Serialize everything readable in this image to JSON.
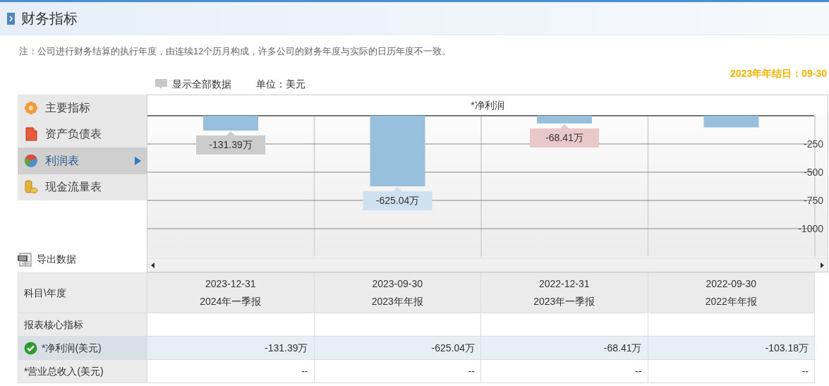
{
  "header": {
    "title": "财务指标"
  },
  "note": "注：公司进行财务结算的执行年度，由连续12个历月构成，许多公司的财务年度与实际的日历年度不一致。",
  "toolbar": {
    "show_all": "显示全部数据",
    "unit": "单位：美元",
    "fiscal_year_end": "2023年年结日：09-30"
  },
  "sidebar": {
    "items": [
      {
        "label": "主要指标",
        "selected": false
      },
      {
        "label": "资产负债表",
        "selected": false
      },
      {
        "label": "利润表",
        "selected": true
      },
      {
        "label": "现金流量表",
        "selected": false
      }
    ]
  },
  "export": "导出数据",
  "chart": {
    "chart_data": {
      "type": "bar",
      "title": "*净利润",
      "values": [
        -131.39,
        -625.04,
        -68.41,
        -103.18
      ],
      "ylim": [
        -1250,
        0
      ],
      "yticks": [
        -250,
        -500,
        -750,
        -1000
      ],
      "grid": true,
      "value_labels": [
        "-131.39万",
        "-625.04万",
        "-68.41万",
        null
      ]
    }
  },
  "table": {
    "corner": "科目\\年度",
    "columns": [
      {
        "date": "2023-12-31",
        "report": "2024年一季报"
      },
      {
        "date": "2023-09-30",
        "report": "2023年年报"
      },
      {
        "date": "2022-12-31",
        "report": "2023年一季报"
      },
      {
        "date": "2022-09-30",
        "report": "2022年年报"
      }
    ],
    "rows": [
      {
        "kind": "section",
        "label": "报表核心指标",
        "selected": false
      },
      {
        "kind": "metric",
        "label": "*净利润(美元)",
        "selected": true,
        "values": [
          "-131.39万",
          "-625.04万",
          "-68.41万",
          "-103.18万"
        ]
      },
      {
        "kind": "metric",
        "label": "*营业总收入(美元)",
        "selected": false,
        "values": [
          "--",
          "--",
          "--",
          "--"
        ]
      }
    ]
  }
}
